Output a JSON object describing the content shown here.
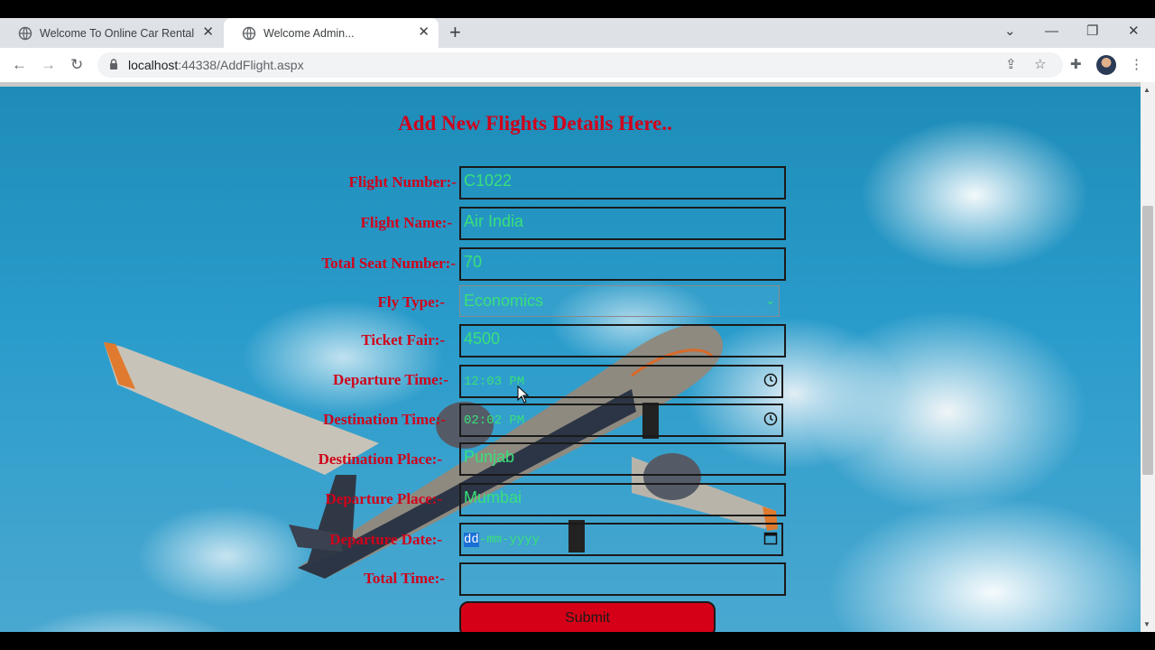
{
  "browser": {
    "tabs": [
      {
        "label": "Welcome To Online Car Rental Pr",
        "active": false
      },
      {
        "label": "Welcome Admin...",
        "active": true
      }
    ],
    "close_glyph": "✕",
    "newtab_glyph": "+",
    "url_host": "localhost",
    "url_rest": ":44338/AddFlight.aspx",
    "controls": {
      "minimize": "—",
      "restore": "❐",
      "close": "✕",
      "dropdown": "⌄"
    },
    "nav": {
      "back": "←",
      "forward": "→",
      "reload": "↻"
    },
    "icons": {
      "share": "⇪",
      "star": "☆",
      "extensions": "✚",
      "menu": "⋮"
    }
  },
  "form": {
    "title": "Add New Flights Details Here..",
    "flight_number": {
      "label": "Flight Number:-",
      "value": "C1022"
    },
    "flight_name": {
      "label": "Flight Name:-",
      "value": "Air India"
    },
    "total_seats": {
      "label": "Total Seat Number:-",
      "value": "70"
    },
    "fly_type": {
      "label": "Fly Type:-",
      "value": "Economics"
    },
    "ticket_fair": {
      "label": "Ticket Fair:-",
      "value": "4500"
    },
    "departure_time": {
      "label": "Departure Time:-",
      "value": "12:03 PM"
    },
    "destination_time": {
      "label": "Destination Time:-",
      "value": "02:02 PM"
    },
    "destination_place": {
      "label": "Destination Place:-",
      "value": "Punjab"
    },
    "departure_place": {
      "label": "Departure Place:-",
      "value": "Mumbai"
    },
    "departure_date": {
      "label": "Departure Date:-",
      "value_dd": "dd",
      "value_rest": "-mm-yyyy"
    },
    "total_time": {
      "label": "Total Time:-",
      "value": ""
    },
    "submit_label": "Submit"
  },
  "colors": {
    "accent": "#d0021b",
    "input_text": "#39e07a",
    "sky": "#2a9ccb"
  }
}
